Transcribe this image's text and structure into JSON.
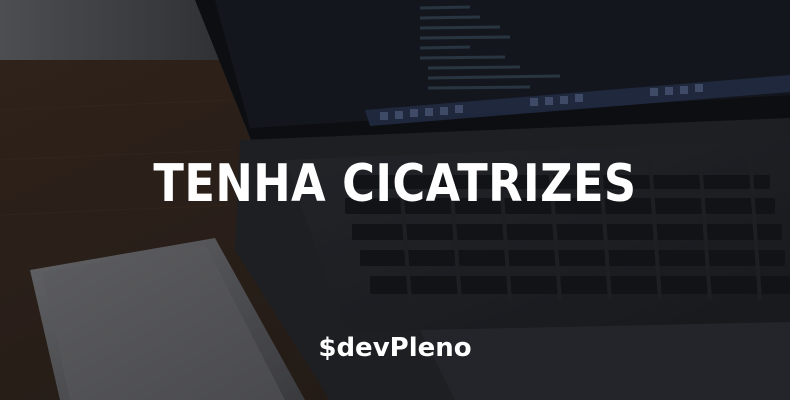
{
  "banner": {
    "headline": "TENHA CICATRIZES",
    "brand_logo_text": "$devPleno"
  },
  "colors": {
    "text": "#ffffff",
    "background": "#1b1d21"
  }
}
